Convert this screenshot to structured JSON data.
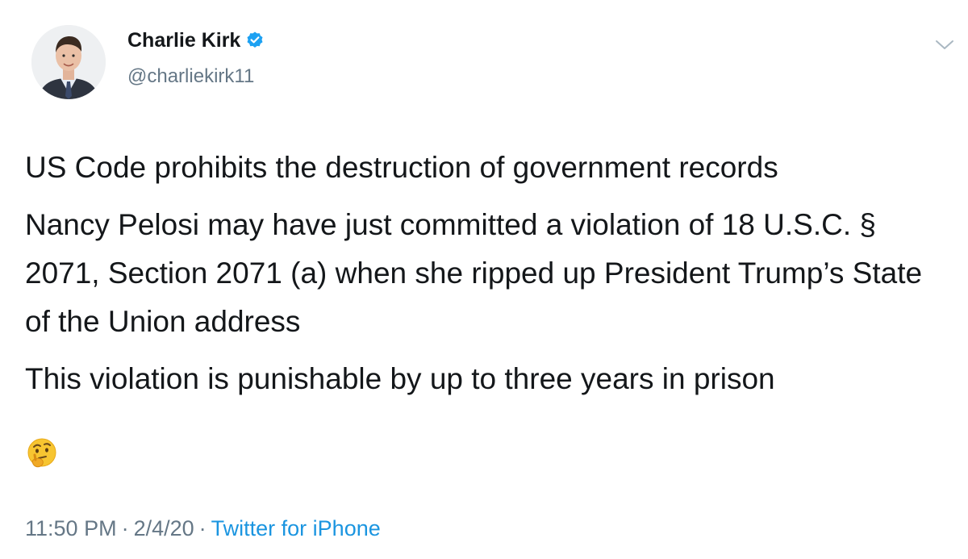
{
  "author": {
    "name": "Charlie Kirk",
    "handle": "@charliekirk11",
    "verified": true
  },
  "tweet": {
    "paragraphs": [
      "US Code prohibits the destruction of government records",
      "Nancy Pelosi may have just committed a violation of 18 U.S.C. § 2071, Section 2071 (a) when she ripped up President Trump’s State of the Union address",
      "This violation is punishable by up to three years in prison"
    ],
    "emoji": "thinking-face-icon"
  },
  "meta": {
    "time": "11:50 PM",
    "separator": "·",
    "date": "2/4/20",
    "source": "Twitter for iPhone"
  },
  "colors": {
    "text": "#14171a",
    "secondary": "#657786",
    "link": "#1b95e0",
    "verified": "#1da1f2"
  }
}
